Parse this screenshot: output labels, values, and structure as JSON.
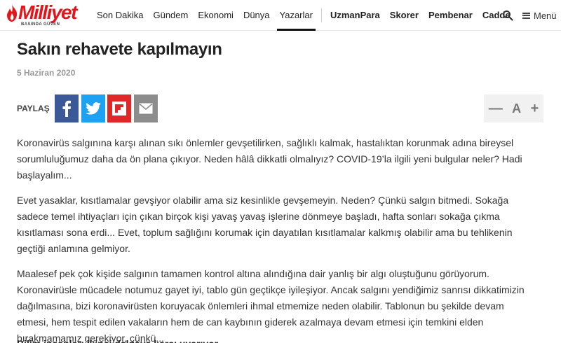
{
  "header": {
    "logo_text": "Milliyet",
    "logo_tagline": "BASINDA GÜVEN",
    "nav": [
      "Son Dakika",
      "Gündem",
      "Ekonomi",
      "Dünya",
      "Yazarlar"
    ],
    "nav_active": "Yazarlar",
    "nav_brands": [
      "UzmanPara",
      "Skorer",
      "Pembenar",
      "Cadde"
    ],
    "menu_label": "Menü",
    "brand_color": "#e3141a"
  },
  "article": {
    "title": "Sakın rehavete kapılmayın",
    "date": "5 Haziran 2020",
    "share_label": "PAYLAŞ",
    "share_buttons": [
      "facebook-icon",
      "twitter-icon",
      "flipboard-icon",
      "email-icon"
    ],
    "font_controls": {
      "decrease": "—",
      "label": "A",
      "increase": "+"
    },
    "paragraphs": [
      "Koronavirüs salgınına karşı alınan sıkı önlemler gevşetilirken, sağlıklı kalmak, hastalıktan korunmak adına bireysel sorumluluğumuz daha da ön plana çıkıyor. Neden hâlâ dikkatli olmalıyız? COVID-19’la ilgili yeni bulgular neler? Hadi başlayalım...",
      "Evet yasaklar, kısıtlamalar gevşiyor olabilir ama siz kesinlikle gevşemeyin. Neden? Çünkü salgın bitmedi. Sokağa sadece temel ihtiyaçları için çıkan birçok kişi yavaş yavaş işlerine dönmeye başladı, hafta sonları sokağa çıkma kısıtlaması sona erdi... Evet, toplum sağlığını korumak için dayatılan kısıtlamalar kalkmış olabilir ama bu tehlikenin geçtiği anlamına gelmiyor.",
      "Maalesef pek çok kişide salgının tamamen kontrol altına alındığına dair yanlış bir algı oluştuğunu görüyorum. Koronavirüsle mücadele notumuz gayet iyi, tablo gün geçtikçe iyileşiyor. Ancak salgını yendiğimiz sanrısı dikkatimizin dağılmasına, bizi koronavirüsten koruyacak önlemleri ihmal etmemize neden olabilir. Tablonun bu şekilde devam etmesi, hem tespit edilen vakaların hem de can kaybının giderek azalmaya devam etmesi için temkini elden bırakmamamız gerekiyor, çünkü..."
    ],
    "subhead": "Bilim insanları ikinci dalgaya karşı uyarıyor"
  }
}
